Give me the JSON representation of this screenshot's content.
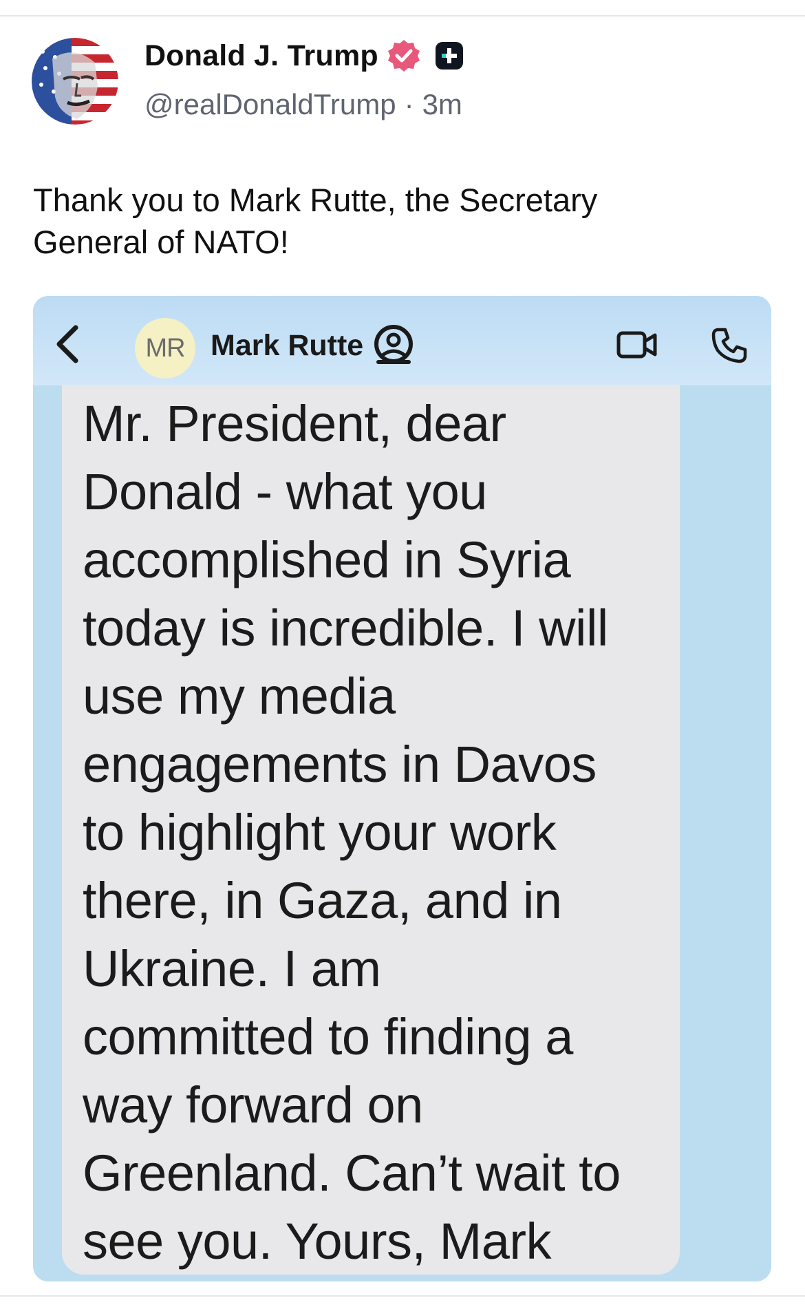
{
  "post": {
    "author_name": "Donald J. Trump",
    "handle": "@realDonaldTrump",
    "separator": "·",
    "time": "3m",
    "text": "Thank you to Mark Rutte, the Secretary\nGeneral of NATO!",
    "icons": {
      "avatar": "profile-avatar-flag",
      "verified": "verified-badge-icon",
      "plus": "plus-badge-icon"
    }
  },
  "embedded_screenshot": {
    "contact_initials": "MR",
    "contact_name": "Mark Rutte",
    "message": "Mr. President, dear\nDonald - what you\naccomplished in Syria\ntoday is incredible. I will\nuse my media\nengagements in Davos\nto highlight your work\nthere, in Gaza, and in\nUkraine. I am\ncommitted to finding a\nway forward on\nGreenland. Can’t wait to\nsee you. Yours, Mark",
    "icons": {
      "back": "chevron-left-icon",
      "contact": "contact-icon",
      "video": "video-camera-icon",
      "phone": "phone-icon"
    },
    "colors": {
      "background": "#bcdcf0",
      "bubble": "#e8e8ea",
      "initials_circle": "#f6f0c5"
    }
  },
  "colors": {
    "verified_badge": "#e8587a",
    "handle_text": "#5f6470"
  }
}
